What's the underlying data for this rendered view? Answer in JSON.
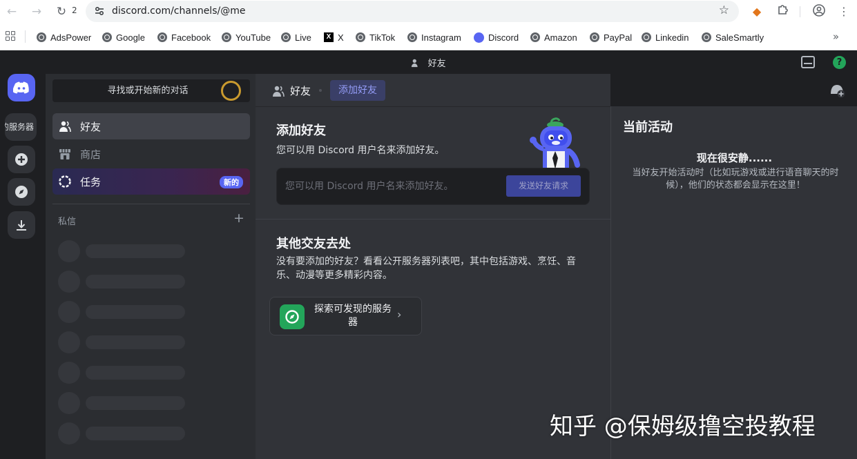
{
  "browser": {
    "tab_count": "2",
    "url": "discord.com/channels/@me",
    "bookmarks": [
      "AdsPower",
      "Google",
      "Facebook",
      "YouTube",
      "Live",
      "X",
      "TikTok",
      "Instagram",
      "Discord",
      "Amazon",
      "PayPal",
      "Linkedin",
      "SaleSmartly"
    ]
  },
  "titlebar": {
    "title": "好友"
  },
  "rail": {
    "server_label": "的服务器"
  },
  "sidebar": {
    "search_label": "寻找或开始新的对话",
    "items": [
      {
        "label": "好友",
        "icon": "friends-icon",
        "active": true
      },
      {
        "label": "商店",
        "icon": "shop-icon",
        "active": false
      },
      {
        "label": "任务",
        "icon": "quest-icon",
        "active": false,
        "badge": "新的"
      }
    ],
    "dm_header": "私信",
    "dm_add": "+"
  },
  "main": {
    "header_title": "好友",
    "add_friend_tab": "添加好友",
    "add_friend_title": "添加好友",
    "add_friend_desc": "您可以用 Discord 用户名来添加好友。",
    "input_placeholder": "您可以用 Discord 用户名来添加好友。",
    "send_button": "发送好友请求",
    "other_title": "其他交友去处",
    "other_desc": "没有要添加的好友？看看公开服务器列表吧，其中包括游戏、烹饪、音乐、动漫等更多精彩内容。",
    "explore_label": "探索可发现的服务器"
  },
  "right_panel": {
    "title": "当前活动",
    "quiet_title": "现在很安静......",
    "quiet_desc": "当好友开始活动时（比如玩游戏或进行语音聊天的时候），他们的状态都会显示在这里！"
  },
  "watermark": "知乎 @保姆级撸空投教程",
  "colors": {
    "blurple": "#5865f2",
    "green": "#23a55a",
    "bg_dark": "#1e1f22",
    "bg_main": "#313338",
    "bg_side": "#2b2d31"
  }
}
